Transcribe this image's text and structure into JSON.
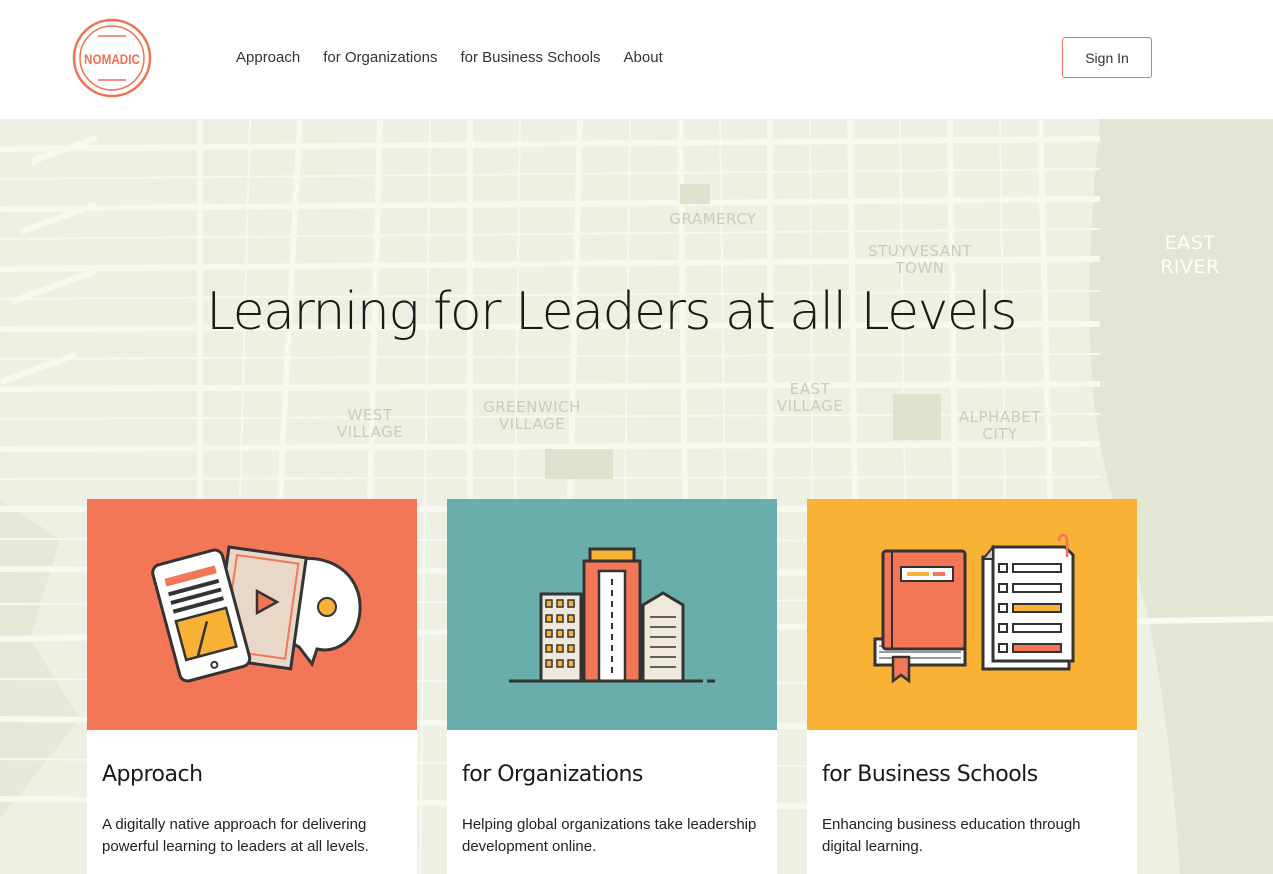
{
  "brand": {
    "logo_text": "NOMADIC",
    "accent": "#ee7150"
  },
  "nav": {
    "items": [
      "Approach",
      "for Organizations",
      "for Business Schools",
      "About"
    ]
  },
  "header": {
    "signin_label": "Sign In"
  },
  "hero": {
    "headline": "Learning for Leaders at all Levels",
    "map_labels": [
      "GRAMERCY",
      "STUYVESANT TOWN",
      "EAST RIVER",
      "WEST VILLAGE",
      "GREENWICH VILLAGE",
      "EAST VILLAGE",
      "ALPHABET CITY"
    ]
  },
  "cards": [
    {
      "title": "Approach",
      "description": "A digitally native approach for delivering powerful learning to leaders at all levels.",
      "color": "#f37757"
    },
    {
      "title": "for Organizations",
      "description": "Helping global organizations take leadership development online.",
      "color": "#6aaeab"
    },
    {
      "title": "for Business Schools",
      "description": "Enhancing business education through digital learning.",
      "color": "#f9b236"
    }
  ]
}
